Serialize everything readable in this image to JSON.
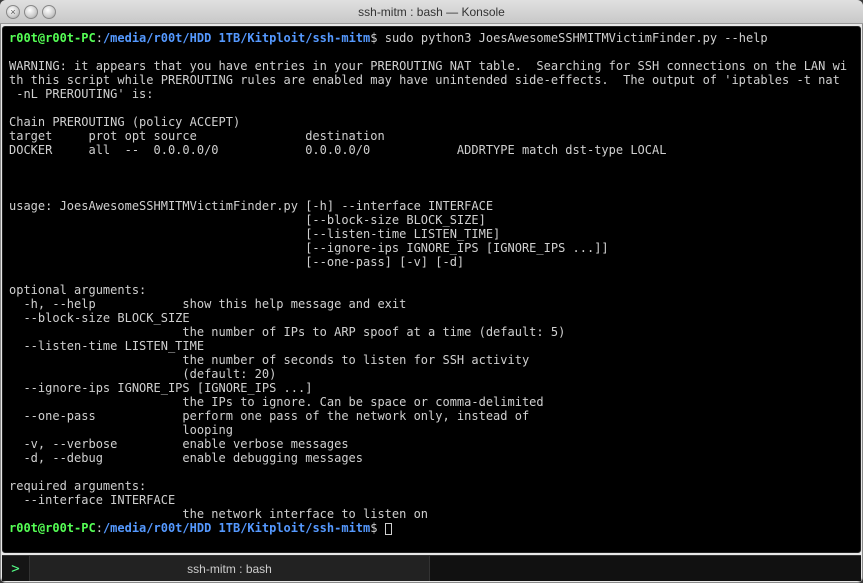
{
  "window": {
    "title": "ssh-mitm : bash — Konsole"
  },
  "prompt1": {
    "user": "r00t@r00t-PC",
    "sep": ":",
    "path": "/media/r00t/HDD 1TB/Kitploit/ssh-mitm",
    "dollar": "$",
    "command": "sudo python3 JoesAwesomeSSHMITMVictimFinder.py --help"
  },
  "output": "\nWARNING: it appears that you have entries in your PREROUTING NAT table.  Searching for SSH connections on the LAN wi\nth this script while PREROUTING rules are enabled may have unintended side-effects.  The output of 'iptables -t nat\n -nL PREROUTING' is:\n\nChain PREROUTING (policy ACCEPT)\ntarget     prot opt source               destination\nDOCKER     all  --  0.0.0.0/0            0.0.0.0/0            ADDRTYPE match dst-type LOCAL\n\n\n\nusage: JoesAwesomeSSHMITMVictimFinder.py [-h] --interface INTERFACE\n                                         [--block-size BLOCK_SIZE]\n                                         [--listen-time LISTEN_TIME]\n                                         [--ignore-ips IGNORE_IPS [IGNORE_IPS ...]]\n                                         [--one-pass] [-v] [-d]\n\noptional arguments:\n  -h, --help            show this help message and exit\n  --block-size BLOCK_SIZE\n                        the number of IPs to ARP spoof at a time (default: 5)\n  --listen-time LISTEN_TIME\n                        the number of seconds to listen for SSH activity\n                        (default: 20)\n  --ignore-ips IGNORE_IPS [IGNORE_IPS ...]\n                        the IPs to ignore. Can be space or comma-delimited\n  --one-pass            perform one pass of the network only, instead of\n                        looping\n  -v, --verbose         enable verbose messages\n  -d, --debug           enable debugging messages\n\nrequired arguments:\n  --interface INTERFACE\n                        the network interface to listen on",
  "prompt2": {
    "user": "r00t@r00t-PC",
    "sep": ":",
    "path": "/media/r00t/HDD 1TB/Kitploit/ssh-mitm",
    "dollar": "$"
  },
  "tab": {
    "label": "ssh-mitm : bash",
    "newtab_icon": ">"
  }
}
